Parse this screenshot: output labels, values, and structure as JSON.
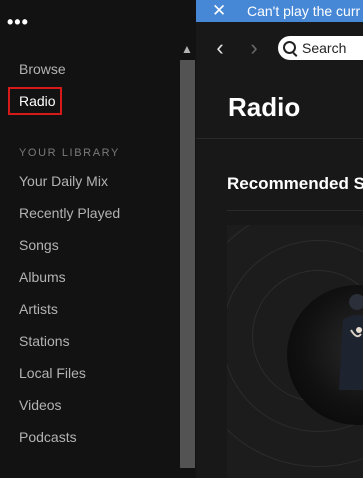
{
  "sidebar": {
    "menu_glyph": "•••",
    "nav": [
      {
        "label": "Browse"
      },
      {
        "label": "Radio"
      }
    ],
    "library_header": "YOUR LIBRARY",
    "library": [
      {
        "label": "Your Daily Mix"
      },
      {
        "label": "Recently Played"
      },
      {
        "label": "Songs"
      },
      {
        "label": "Albums"
      },
      {
        "label": "Artists"
      },
      {
        "label": "Stations"
      },
      {
        "label": "Local Files"
      },
      {
        "label": "Videos"
      },
      {
        "label": "Podcasts"
      }
    ]
  },
  "banner": {
    "close_glyph": "✕",
    "message": "Can't play the curr"
  },
  "topbar": {
    "back_glyph": "‹",
    "forward_glyph": "›",
    "search_label": "Search"
  },
  "main": {
    "page_title": "Radio",
    "section_title": "Recommended S"
  },
  "colors": {
    "accent_banner": "#4687d6",
    "highlight_box": "#d61a1a",
    "sidebar_bg": "#121212",
    "main_bg": "#181818"
  }
}
